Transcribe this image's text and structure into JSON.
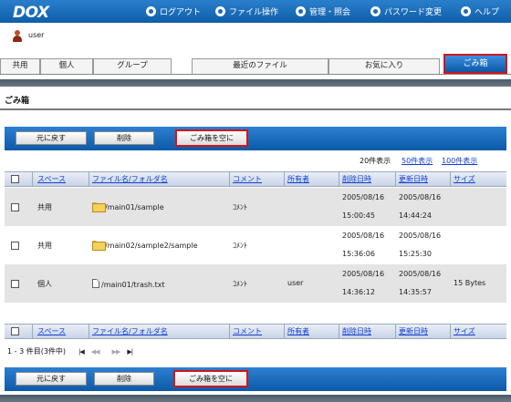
{
  "header": {
    "logo": "DOX",
    "nav": [
      {
        "label": "ログアウト",
        "icon": "logout-icon"
      },
      {
        "label": "ファイル操作",
        "icon": "file-ops-icon"
      },
      {
        "label": "管理・照会",
        "icon": "admin-icon"
      },
      {
        "label": "パスワード変更",
        "icon": "refresh-icon"
      },
      {
        "label": "ヘルプ",
        "icon": "help-icon"
      }
    ]
  },
  "user": {
    "name": "user"
  },
  "tabs": [
    {
      "label": "共用"
    },
    {
      "label": "個人"
    },
    {
      "label": "グループ"
    },
    {
      "label": "最近のファイル"
    },
    {
      "label": "お気に入り"
    },
    {
      "label": "ごみ箱",
      "active": true
    }
  ],
  "page": {
    "title": "ごみ箱"
  },
  "toolbar": {
    "restore": "元に戻す",
    "delete": "削除",
    "empty": "ごみ箱を空に"
  },
  "pager": {
    "current": "20件表示",
    "opt50": "50件表示",
    "opt100": "100件表示"
  },
  "columns": {
    "space": "スペース",
    "name": "ファイル名/フォルダ名",
    "comment": "コメント",
    "owner": "所有者",
    "deleted": "削除日時",
    "updated": "更新日時",
    "size": "サイズ"
  },
  "rows": [
    {
      "space": "共用",
      "type": "folder",
      "name": "/main01/sample",
      "comment": "ｺﾒﾝﾄ",
      "owner": "",
      "deleted_date": "2005/08/16",
      "deleted_time": "15:00:45",
      "updated_date": "2005/08/16",
      "updated_time": "14:44:24",
      "size": ""
    },
    {
      "space": "共用",
      "type": "folder",
      "name": "/main02/sample2/sample",
      "comment": "ｺﾒﾝﾄ",
      "owner": "",
      "deleted_date": "2005/08/16",
      "deleted_time": "15:36:06",
      "updated_date": "2005/08/16",
      "updated_time": "15:25:30",
      "size": ""
    },
    {
      "space": "個人",
      "type": "file",
      "name": "/main01/trash.txt",
      "comment": "ｺﾒﾝﾄ",
      "owner": "user",
      "deleted_date": "2005/08/16",
      "deleted_time": "14:36:12",
      "updated_date": "2005/08/16",
      "updated_time": "14:35:57",
      "size": "15 Bytes"
    }
  ],
  "footer": {
    "count": "1 - 3 件目(3件中)",
    "first": "|◀",
    "prev": "◀◀",
    "next": "▶▶",
    "last": "▶|"
  }
}
